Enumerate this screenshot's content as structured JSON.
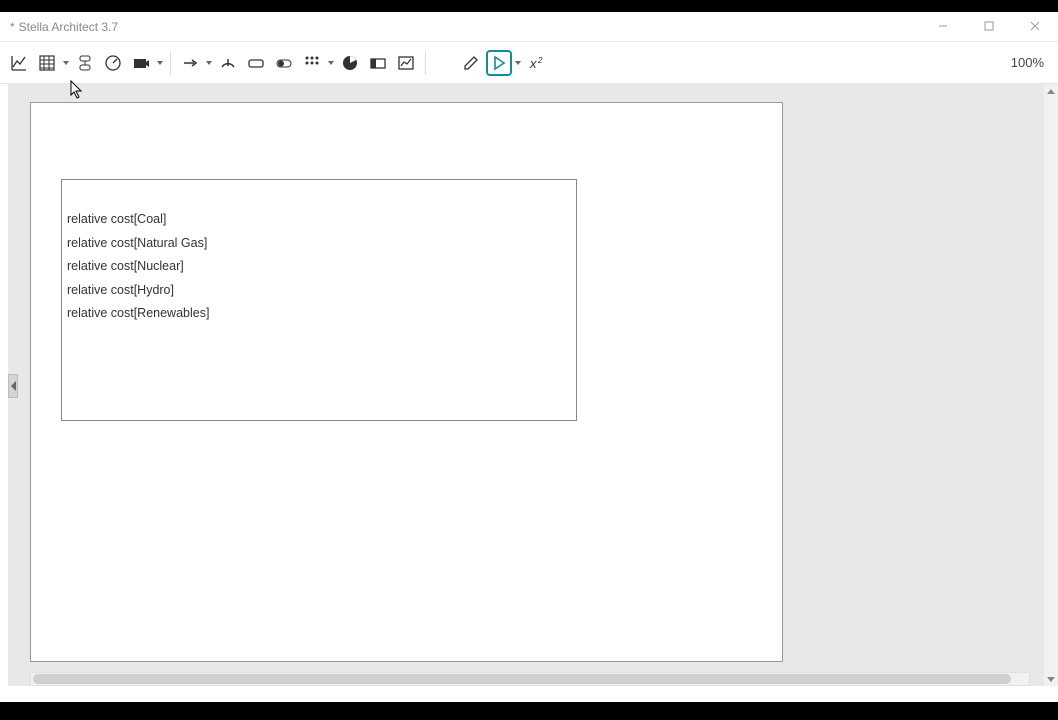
{
  "title": "Stella Architect 3.7",
  "zoom": "100%",
  "variables": [
    "relative cost[Coal]",
    "relative cost[Natural Gas]",
    "relative cost[Nuclear]",
    "relative cost[Hydro]",
    "relative cost[Renewables]"
  ]
}
